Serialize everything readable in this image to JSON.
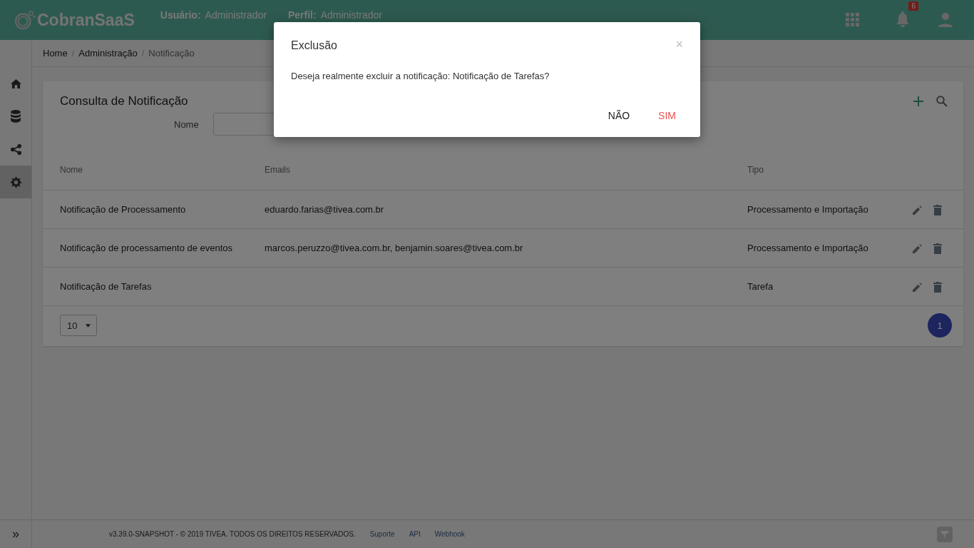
{
  "header": {
    "brand": "CobranSaaS",
    "user_label": "Usuário:",
    "user": "Administrador",
    "profile_label": "Perfil:",
    "profile": "Administrador",
    "notifications": "6"
  },
  "breadcrumb": {
    "separator": "/",
    "items": [
      "Home",
      "Administração",
      "Notificação"
    ]
  },
  "sidebar": {
    "items": [
      {
        "kind": "home",
        "selected": false
      },
      {
        "kind": "database",
        "selected": false
      },
      {
        "kind": "share",
        "selected": false
      },
      {
        "kind": "gear",
        "selected": true
      }
    ]
  },
  "card": {
    "title": "Consulta de Notificação",
    "filter_label": "Nome"
  },
  "table": {
    "columns": [
      "Nome",
      "Emails",
      "Tipo"
    ],
    "rows": [
      [
        "Notificação de Processamento",
        "eduardo.farias@tivea.com.br",
        "Processamento e Importação"
      ],
      [
        "Notificação de processamento de eventos",
        "marcos.peruzzo@tivea.com.br, benjamin.soares@tivea.com.br",
        "Processamento e Importação"
      ],
      [
        "Notificação de Tarefas",
        "",
        "Tarefa"
      ]
    ]
  },
  "pagination": {
    "page_size": "10",
    "pages": [
      {
        "label": "1",
        "selected": true
      }
    ]
  },
  "footer": {
    "text": "v3.39.0-SNAPSHOT - © 2019 TIVEA. TODOS OS DIREITOS RESERVADOS.",
    "links": [
      "Suporte",
      "API",
      "Webhook"
    ],
    "toggle": "»"
  },
  "dialog": {
    "title": "Exclusão",
    "close": "×",
    "message": "Deseja realmente excluir a notificação: Notificação de Tarefas?",
    "buttons": [
      {
        "label": "NÃO",
        "kind": "cancel"
      },
      {
        "label": "SIM",
        "kind": "confirm"
      }
    ]
  }
}
